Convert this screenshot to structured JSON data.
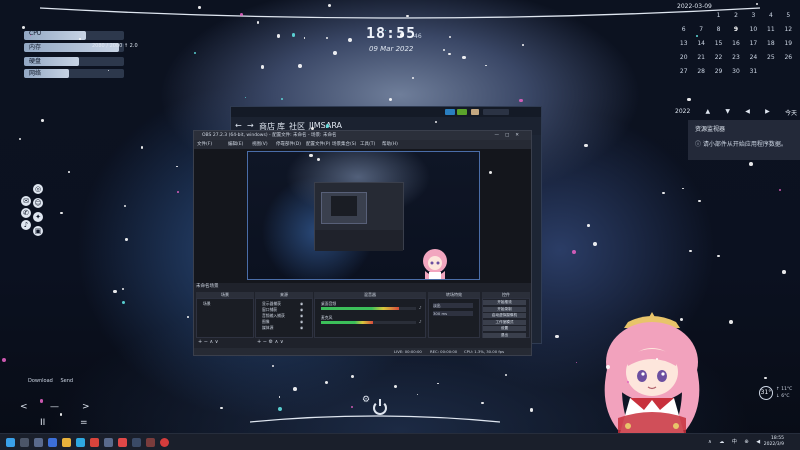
{
  "meters": [
    {
      "label": "CPU",
      "value_text": "",
      "fill": 0.62
    },
    {
      "label": "内存",
      "value_text": "2080 / 2080  ↑ 2.0",
      "fill": 0.95
    },
    {
      "label": "硬盘",
      "value_text": "",
      "fill": 0.55
    },
    {
      "label": "网络",
      "value_text": "",
      "fill": 0.45
    }
  ],
  "clock": {
    "time": "18:55",
    "seconds": "46",
    "date": "09 Mar 2022"
  },
  "calendar": {
    "header": "2022-03-09",
    "cells": [
      "",
      "",
      "1",
      "2",
      "3",
      "4",
      "5",
      "6",
      "7",
      "8",
      "9",
      "10",
      "11",
      "12",
      "13",
      "14",
      "15",
      "16",
      "17",
      "18",
      "19",
      "20",
      "21",
      "22",
      "23",
      "24",
      "25",
      "26",
      "27",
      "28",
      "29",
      "30",
      "31",
      "",
      ""
    ],
    "nav_year": "2022",
    "nav_arrows": [
      "▲",
      "▼"
    ],
    "nav_month_arrows": [
      "◀",
      "▶"
    ],
    "nav_today": "今天"
  },
  "notification": {
    "title": "资源监视器",
    "text": "请小部件从开始应用程序数据。"
  },
  "steam": {
    "nav": [
      "←",
      "→",
      "商店",
      "库",
      "社区",
      "JIMSARA"
    ]
  },
  "obs": {
    "title": "OBS 27.2.3 (64-bit, windows) - 配置文件: 未命名 - 场景: 未命名",
    "menu": [
      "文件(F)",
      "编辑(E)",
      "视图(V)",
      "停靠部件(D)",
      "配置文件(P)",
      "场景集合(S)",
      "工具(T)",
      "帮助(H)"
    ],
    "scene_label": "未命名场景",
    "panels": {
      "scenes": "场景",
      "sources": "来源",
      "mixer": "混音器",
      "transitions": "转场特效",
      "controls": "控件"
    },
    "scene_items": [
      "场景"
    ],
    "source_items": [
      "显示器捕获",
      "窗口捕获",
      "音频输入捕获",
      "图像",
      "媒体源"
    ],
    "mixer_items": [
      "桌面音频",
      "麦克风"
    ],
    "mixer_levels": [
      0.82,
      0.55
    ],
    "transition_values": [
      "淡出",
      "300 ms"
    ],
    "controls": [
      "开始推流",
      "开始录制",
      "启动虚拟摄像机",
      "工作室模式",
      "设置",
      "退出"
    ],
    "status": [
      "LIVE: 00:00:00",
      "REC: 00:00:00",
      "CPU: 1.3%, 30.00 fps"
    ]
  },
  "media_widget": {
    "labels": [
      "Download",
      "Send"
    ],
    "controls": [
      "<",
      "—",
      ">",
      "II",
      "="
    ]
  },
  "weather": {
    "temp": "31°",
    "hi": "↑ 11°C",
    "lo": "↓ 6°C"
  },
  "taskbar": {
    "tray": "∧ ☁ 中 ⊕ ◀",
    "time": "18:55",
    "date": "2022/3/9"
  },
  "colors": {
    "accent": "#4a6da8",
    "steam_green": "#5ba32b",
    "steam_blue": "#2a7fc0",
    "meter_fill": "#c7d3e4"
  }
}
